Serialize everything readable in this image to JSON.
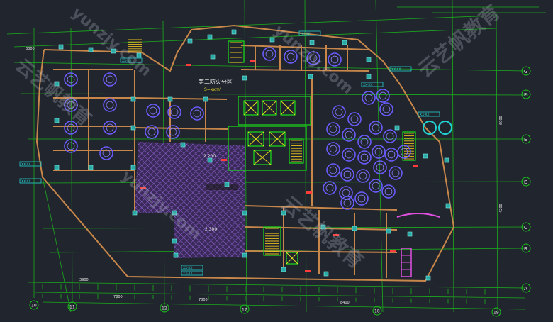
{
  "drawing": {
    "zone_label": "第二防火分区",
    "zone_area": "S=xxm²",
    "axis_letters": [
      "G",
      "F",
      "E",
      "D",
      "C",
      "B",
      "A"
    ],
    "axis_numbers": [
      "10",
      "11",
      "12",
      "17",
      "18",
      "19"
    ],
    "dim_labels": [
      "3900",
      "7800",
      "7800",
      "8400",
      "6000",
      "4200",
      "3300"
    ],
    "tags": [
      "XX-XX",
      "XX-XX",
      "XX-XX",
      "XX-XX",
      "XX-XX",
      "XX-XX",
      "XX-XX",
      "XX-XX"
    ],
    "room_codes": [
      "2.200",
      "2.300"
    ],
    "colors": {
      "background": "#21252e",
      "grid": "#19c419",
      "wall": "#c8874a",
      "column": "#2aa9a5",
      "tables": "#6a5cff",
      "hatch": "#7a4fb0",
      "label": "#22d3d3",
      "marker": "#ff3b3b"
    }
  },
  "watermarks": [
    "yunzjy.com",
    "云艺帆教育",
    "yunzjy.com",
    "云艺帆教育",
    "yunzjy.com",
    "云艺帆教育"
  ]
}
